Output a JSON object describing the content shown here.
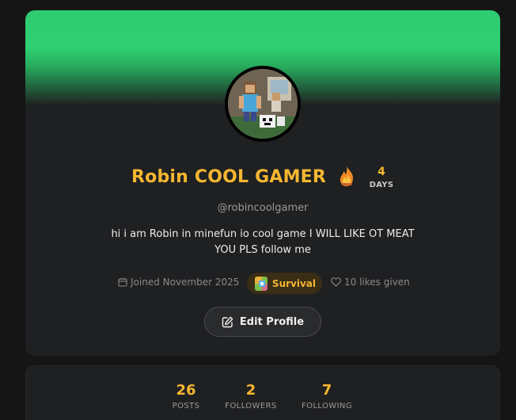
{
  "profile": {
    "display_name": "Robin COOL GAMER",
    "username": "@robincoolgamer",
    "bio": "hi i am  Robin in minefun io  cool game I WILL LIKE OT MEAT\nYOU PLS follow me",
    "streak": {
      "count": "4",
      "label": "DAYS",
      "icon": "flame-icon"
    },
    "joined": "Joined November 2025",
    "mode": {
      "label": "Survival",
      "icon": "survival-mode-icon"
    },
    "likes_given": "10 likes given",
    "edit_label": "Edit Profile"
  },
  "stats": [
    {
      "value": "26",
      "label": "POSTS"
    },
    {
      "value": "2",
      "label": "FOLLOWERS"
    },
    {
      "value": "7",
      "label": "FOLLOWING"
    }
  ],
  "colors": {
    "accent": "#f5b731",
    "banner": "#2ecc71",
    "card": "#1f2022",
    "background": "#151515"
  }
}
